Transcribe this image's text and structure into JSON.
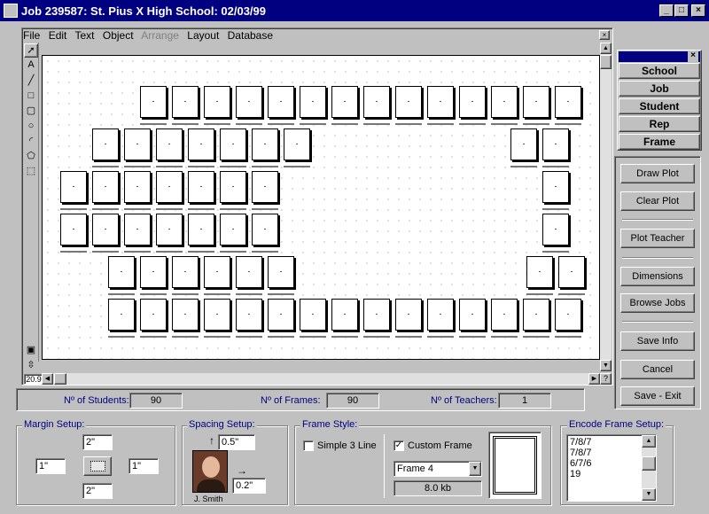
{
  "window": {
    "title": "Job 239587: St. Pius X High School: 02/03/99"
  },
  "menu": [
    "File",
    "Edit",
    "Text",
    "Object",
    "Arrange",
    "Layout",
    "Database"
  ],
  "menu_disabled": "Arrange",
  "zoom": "20.9",
  "nav": {
    "school": "School",
    "job": "Job",
    "student": "Student",
    "rep": "Rep",
    "frame": "Frame"
  },
  "actions": {
    "draw": "Draw Plot",
    "clear": "Clear Plot",
    "plot_teacher": "Plot Teacher",
    "dimensions": "Dimensions",
    "browse": "Browse Jobs",
    "save_info": "Save Info",
    "cancel": "Cancel",
    "save_exit": "Save - Exit"
  },
  "stats": {
    "students_label": "Nº of Students:",
    "students": "90",
    "frames_label": "Nº of Frames:",
    "frames": "90",
    "teachers_label": "Nº of Teachers:",
    "teachers": "1"
  },
  "margin": {
    "title": "Margin Setup:",
    "top": "2\"",
    "left": "1\"",
    "right": "1\"",
    "bottom": "2\""
  },
  "spacing": {
    "title": "Spacing Setup:",
    "vertical": "0.5\"",
    "horizontal": "0.2\"",
    "photo_caption": "J. Smith"
  },
  "frame_style": {
    "title": "Frame Style:",
    "simple_label": "Simple 3 Line",
    "simple_checked": false,
    "custom_label": "Custom Frame",
    "custom_checked": true,
    "selected": "Frame 4",
    "size": "8.0 kb"
  },
  "encode": {
    "title": "Encode Frame Setup:",
    "items": [
      "7/8/7",
      "7/8/7",
      "6/7/6",
      "19"
    ]
  },
  "colors": {
    "titlebar": "#000080",
    "face": "#c0c0c0",
    "label": "#000080"
  }
}
